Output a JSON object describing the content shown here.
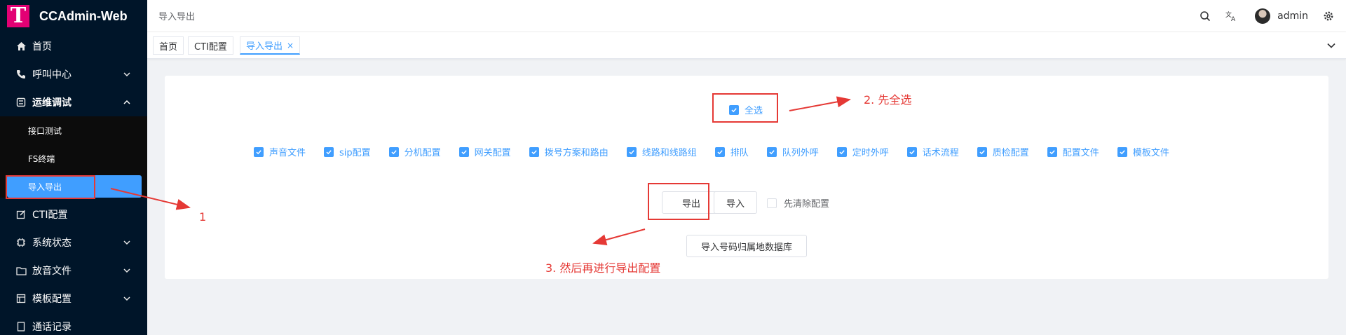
{
  "app": {
    "title": "CCAdmin-Web",
    "logo_letter": "T",
    "logo_color": "#e20074"
  },
  "sidebar": {
    "items": [
      {
        "label": "首页",
        "icon": "home-icon"
      },
      {
        "label": "呼叫中心",
        "icon": "phone-icon"
      },
      {
        "label": "运维调试",
        "icon": "debug-icon"
      },
      {
        "label": "CTI配置",
        "icon": "edit-icon"
      },
      {
        "label": "系统状态",
        "icon": "cpu-icon"
      },
      {
        "label": "放音文件",
        "icon": "folder-icon"
      },
      {
        "label": "模板配置",
        "icon": "template-icon"
      },
      {
        "label": "通话记录",
        "icon": "record-icon"
      }
    ],
    "sub_items": [
      {
        "label": "接口测试"
      },
      {
        "label": "FS终端"
      },
      {
        "label": "导入导出"
      }
    ]
  },
  "header": {
    "breadcrumb": "导入导出",
    "username": "admin",
    "icons": [
      "search-icon",
      "translate-icon",
      "avatar",
      "settings-icon"
    ]
  },
  "tabs": [
    {
      "label": "首页"
    },
    {
      "label": "CTI配置"
    },
    {
      "label": "导入导出",
      "close": "×",
      "active": true
    }
  ],
  "main": {
    "check_all": "全选",
    "options": [
      "声音文件",
      "sip配置",
      "分机配置",
      "网关配置",
      "拨号方案和路由",
      "线路和线路组",
      "排队",
      "队列外呼",
      "定时外呼",
      "话术流程",
      "质检配置",
      "配置文件",
      "模板文件"
    ],
    "export_button": "导出",
    "import_button": "导入",
    "clear_label": "先清除配置",
    "import_db_button": "导入号码归属地数据库"
  },
  "annotations": {
    "step1": "1",
    "step2": "2. 先全选",
    "step3": "3. 然后再进行导出配置"
  },
  "colors": {
    "primary": "#409eff",
    "sidebar_bg": "#001529",
    "annotation": "#e53935"
  }
}
